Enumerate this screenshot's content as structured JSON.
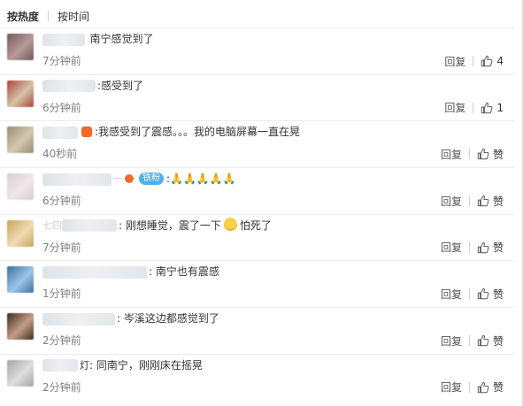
{
  "sort": {
    "hot": "按热度",
    "time": "按时间"
  },
  "comments": [
    {
      "content": "南宁感觉到了",
      "time": "7分钟前",
      "reply": "回复",
      "like": "4",
      "avatar_colors": [
        "#6f5a57",
        "#b89a97"
      ]
    },
    {
      "content": "感受到了",
      "time": "6分钟前",
      "reply": "回复",
      "like": "1",
      "avatar_colors": [
        "#a9433f",
        "#d7c4a8"
      ]
    },
    {
      "content": "我感受到了震感。。。我的电脑屏幕一直在晃",
      "time": "40秒前",
      "reply": "回复",
      "like": "赞",
      "avatar_colors": [
        "#9a8c6e",
        "#d3c8b2"
      ]
    },
    {
      "name_hint": "一",
      "fan_badge": "铁粉",
      "content": "🙏🙏🙏🙏🙏",
      "time": "6分钟前",
      "reply": "回复",
      "like": "赞",
      "avatar_colors": [
        "#d9cdd0",
        "#efe7ea"
      ]
    },
    {
      "name_hint": "七四",
      "content": "刚想睡觉，震了一下",
      "content_after": "怕死了",
      "time": "7分钟前",
      "reply": "回复",
      "like": "赞",
      "avatar_colors": [
        "#c9a45a",
        "#eedcb3"
      ]
    },
    {
      "content": "南宁也有震感",
      "time": "1分钟前",
      "reply": "回复",
      "like": "赞",
      "avatar_colors": [
        "#3a6fa2",
        "#9cc5e6"
      ]
    },
    {
      "content": "岑溪这边都感觉到了",
      "time": "2分钟前",
      "reply": "回复",
      "like": "赞",
      "avatar_colors": [
        "#3e2a22",
        "#c49d86"
      ]
    },
    {
      "name_hint": "灯",
      "content": "同南宁，刚刚床在摇晃",
      "time": "2分钟前",
      "reply": "回复",
      "like": "赞",
      "avatar_colors": [
        "#a6a6a6",
        "#dedede"
      ]
    }
  ]
}
